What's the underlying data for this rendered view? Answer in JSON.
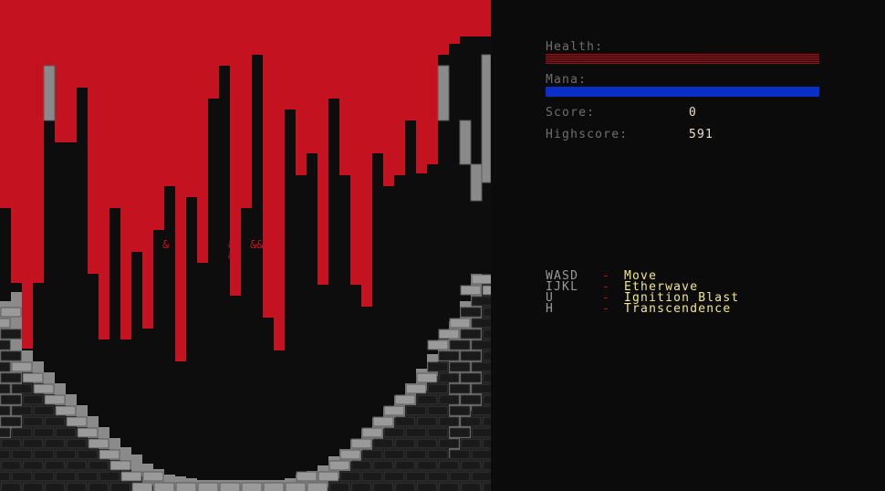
{
  "colors": {
    "blood": "#c41221",
    "void": "#0d0d0e",
    "brick": "#8a8a8a",
    "mana": "#0a2fc7",
    "glyph": "#c41221",
    "dash": "#c41221"
  },
  "playfield": {
    "glyphs": [
      "&",
      "&",
      "&&",
      "&"
    ]
  },
  "hud": {
    "health_label": "Health:",
    "health_fraction": 1.0,
    "mana_label": "Mana:",
    "mana_fraction": 1.0,
    "score_label": "Score:",
    "score_value": "0",
    "highscore_label": "Highscore:",
    "highscore_value": "591"
  },
  "controls": [
    {
      "key": "WASD",
      "desc": "Move"
    },
    {
      "key": "IJKL",
      "desc": "Etherwave"
    },
    {
      "key": "U",
      "desc": "Ignition Blast"
    },
    {
      "key": "H",
      "desc": "Transcendence"
    }
  ]
}
